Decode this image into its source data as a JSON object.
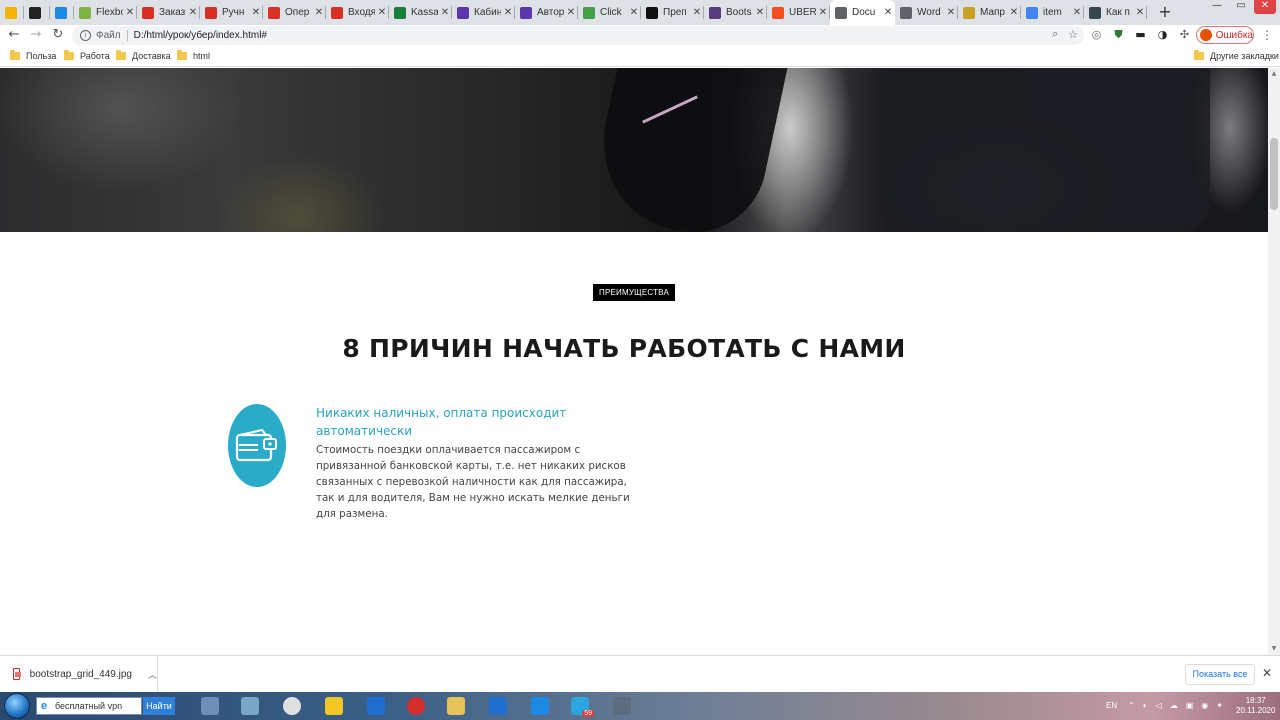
{
  "browser": {
    "tabs": [
      {
        "title": "",
        "icon": "google-drive-icon",
        "color": "#f4b400",
        "active": false,
        "has_close": false
      },
      {
        "title": "",
        "icon": "chrome-like-icon",
        "color": "#222222",
        "active": false,
        "has_close": false
      },
      {
        "title": "",
        "icon": "edge-e-icon",
        "color": "#1e88e5",
        "active": false,
        "has_close": false
      },
      {
        "title": "Flexbo",
        "icon": "frog-icon",
        "color": "#7cb342",
        "active": false,
        "has_close": true
      },
      {
        "title": "Заказ",
        "icon": "gmail-icon",
        "color": "#d93025",
        "active": false,
        "has_close": true
      },
      {
        "title": "Ручн",
        "icon": "gmail-icon",
        "color": "#d93025",
        "active": false,
        "has_close": true
      },
      {
        "title": "Опер",
        "icon": "gmail-icon",
        "color": "#d93025",
        "active": false,
        "has_close": true
      },
      {
        "title": "Входя",
        "icon": "gmail-icon",
        "color": "#d93025",
        "active": false,
        "has_close": true
      },
      {
        "title": "Kassa",
        "icon": "sheets-icon",
        "color": "#188038",
        "active": false,
        "has_close": true
      },
      {
        "title": "Кабин",
        "icon": "square-purple-icon",
        "color": "#5e35b1",
        "active": false,
        "has_close": true
      },
      {
        "title": "Автор",
        "icon": "square-purple-icon",
        "color": "#5e35b1",
        "active": false,
        "has_close": true
      },
      {
        "title": "Click",
        "icon": "clickup-icon",
        "color": "#43a047",
        "active": false,
        "has_close": true
      },
      {
        "title": "Преп",
        "icon": "on-icon",
        "color": "#111111",
        "active": false,
        "has_close": true
      },
      {
        "title": "Boots",
        "icon": "bootstrap-icon",
        "color": "#563d7c",
        "active": false,
        "has_close": true
      },
      {
        "title": "UBER",
        "icon": "figma-icon",
        "color": "#f24e1e",
        "active": false,
        "has_close": true
      },
      {
        "title": "Docu",
        "icon": "globe-icon",
        "color": "#5f6368",
        "active": true,
        "has_close": true
      },
      {
        "title": "Word",
        "icon": "globe-icon",
        "color": "#5f6368",
        "active": false,
        "has_close": true
      },
      {
        "title": "Мапр",
        "icon": "coin-icon",
        "color": "#c9a227",
        "active": false,
        "has_close": true
      },
      {
        "title": "item",
        "icon": "google-icon",
        "color": "#4285f4",
        "active": false,
        "has_close": true
      },
      {
        "title": "Как п",
        "icon": "window-icon",
        "color": "#37474f",
        "active": false,
        "has_close": true
      }
    ],
    "new_tab": "+",
    "window_controls": {
      "minimize": "—",
      "maximize": "▭",
      "close": "✕"
    },
    "address": {
      "scheme": "Файл",
      "url": "D:/html/урок/убер/index.html#"
    },
    "profile_error_label": "Ошибка",
    "bookmarks": [
      "Польза",
      "Работа",
      "Доставка",
      "html"
    ],
    "other_bookmarks": "Другие закладки"
  },
  "page": {
    "badge": "ПРЕИМУЩЕСТВА",
    "heading": "8 ПРИЧИН НАЧАТЬ РАБОТАТЬ С НАМИ",
    "feature": {
      "icon": "wallet-icon",
      "title": "Никаких наличных, оплата происходит автоматически",
      "text": "Стоимость поездки оплачивается пассажиром с привязанной банковской карты, т.е. нет никаких рисков связанных с перевозкой наличности как для пассажира, так и для водителя, Вам не нужно искать мелкие деньги для размена."
    },
    "colors": {
      "accent": "#2aacc8",
      "badge_bg": "#000000"
    }
  },
  "downloads": {
    "file_name": "bootstrap_grid_449.jpg",
    "show_all": "Показать все"
  },
  "taskbar": {
    "search_placeholder": "бесплатный vpn",
    "search_button": "Найти",
    "apps": [
      "file-icon",
      "notepad-icon",
      "chrome-icon",
      "avast-icon",
      "maxthon-icon",
      "opera-icon",
      "explorer-icon",
      "maxthon-icon",
      "vscode-icon",
      "telegram-icon",
      "calculator-icon"
    ],
    "telegram_badge": "59",
    "language": "EN",
    "time": "18:37",
    "date": "20.11.2020"
  }
}
